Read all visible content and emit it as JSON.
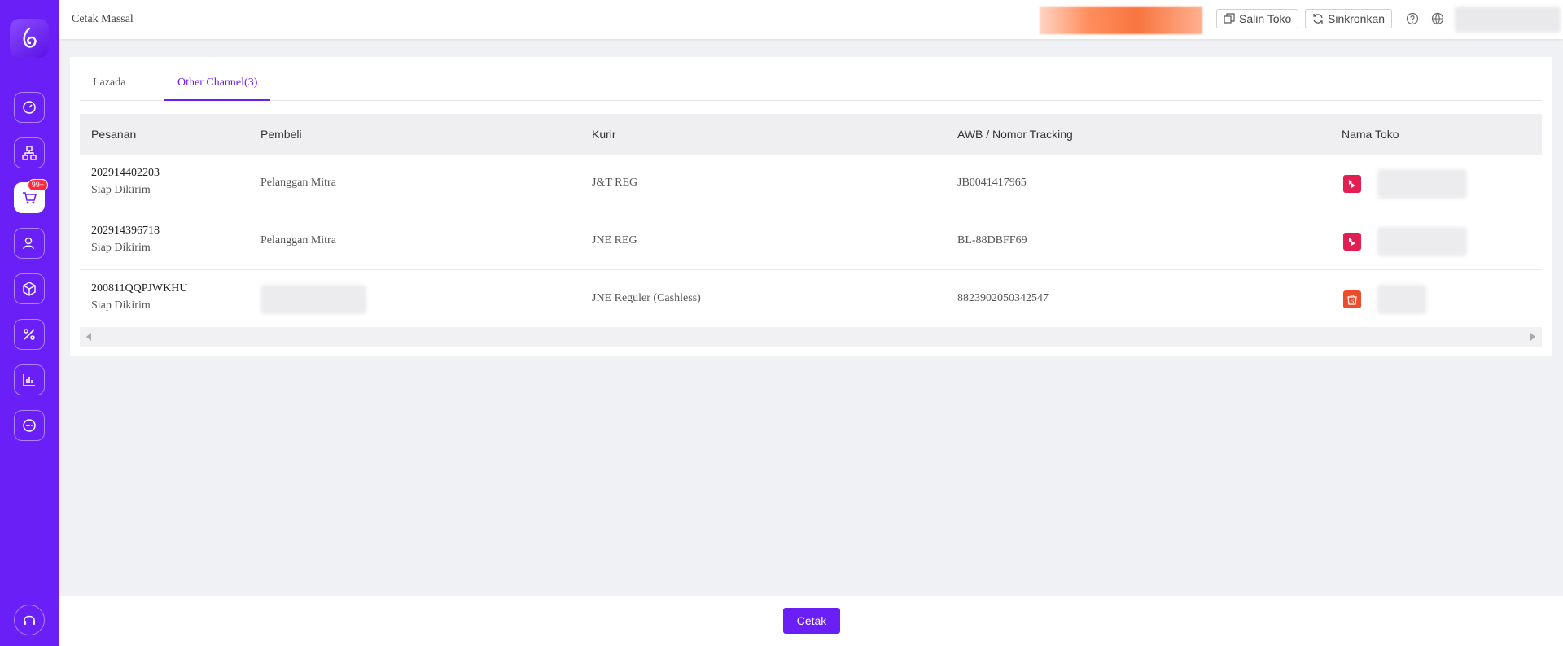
{
  "header": {
    "title": "Cetak Massal",
    "copy_shop_label": "Salin Toko",
    "sync_label": "Sinkronkan"
  },
  "sidebar": {
    "badge": "99+",
    "items": [
      "dashboard-icon",
      "sitemap-icon",
      "cart-icon",
      "users-icon",
      "box-icon",
      "percent-icon",
      "chart-icon",
      "chat-icon"
    ],
    "support": "headset-icon"
  },
  "tabs": [
    {
      "label": "Lazada",
      "active": false
    },
    {
      "label": "Other Channel(3)",
      "active": true
    }
  ],
  "table": {
    "columns": [
      "Pesanan",
      "Pembeli",
      "Kurir",
      "AWB / Nomor Tracking",
      "Nama Toko"
    ],
    "rows": [
      {
        "order": "202914402203",
        "status": "Siap Dikirim",
        "buyer": "Pelanggan Mitra",
        "courier": "J&T REG",
        "awb": "JB0041417965",
        "channel": "bukalapak"
      },
      {
        "order": "202914396718",
        "status": "Siap Dikirim",
        "buyer": "Pelanggan Mitra",
        "courier": "JNE REG",
        "awb": "BL-88DBFF69",
        "channel": "bukalapak"
      },
      {
        "order": "200811QQPJWKHU",
        "status": "Siap Dikirim",
        "buyer": "",
        "courier": "JNE Reguler (Cashless)",
        "awb": "8823902050342547",
        "channel": "shopee"
      }
    ]
  },
  "footer": {
    "print_label": "Cetak"
  },
  "colors": {
    "accent": "#6a1ff7",
    "bukalapak": "#e31e52",
    "shopee": "#ee4d2d"
  }
}
